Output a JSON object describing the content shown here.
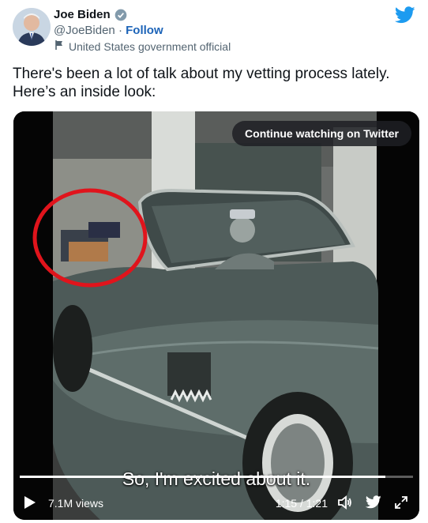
{
  "tweet": {
    "author_name": "Joe Biden",
    "handle": "@JoeBiden",
    "separator": "·",
    "follow_label": "Follow",
    "label": "United States government official",
    "text": "There's been a lot of talk about my vetting process lately. Here’s an inside look:"
  },
  "video": {
    "continue_label": "Continue watching on Twitter",
    "caption": "So, I'm excited about it.",
    "views": "7.1M views",
    "time": "1:15 / 1:21",
    "progress_fraction": 0.93
  },
  "colors": {
    "twitter_blue": "#1d9bf0",
    "follow_blue": "#1d64b8",
    "annotation_red": "#e0141c"
  },
  "icons": [
    "verified-badge-icon",
    "twitter-bird-icon",
    "flag-icon",
    "play-icon",
    "volume-icon",
    "expand-icon"
  ]
}
